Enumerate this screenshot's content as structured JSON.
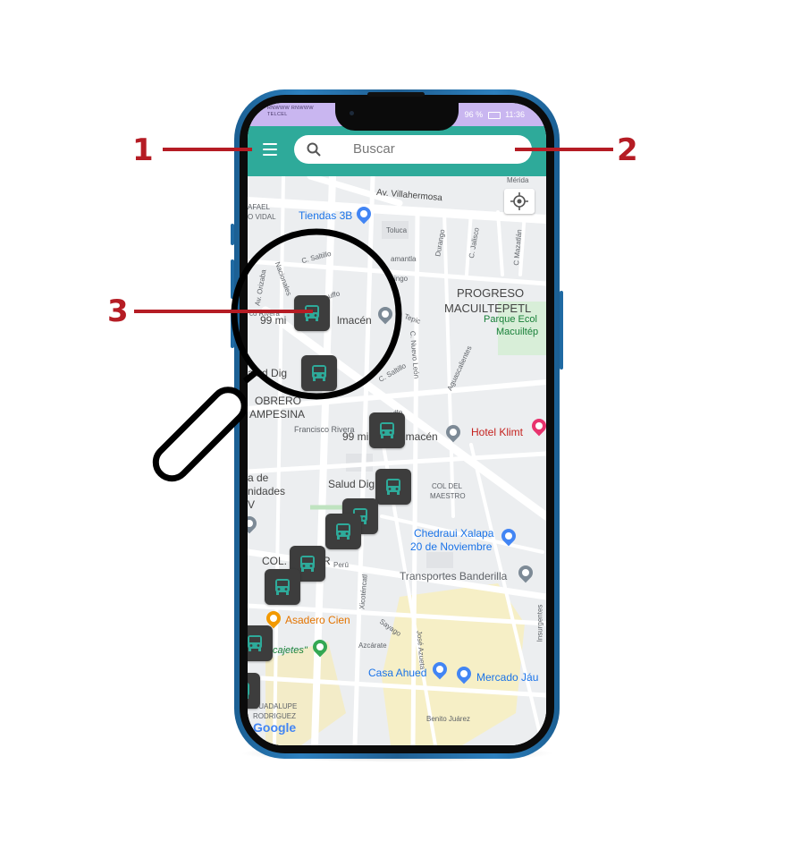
{
  "status_bar": {
    "carrier_top": "RNWWW RNWWW",
    "carrier": "TELCEL",
    "battery": "96 %",
    "time": "11:36"
  },
  "search": {
    "placeholder": "Buscar"
  },
  "map_labels": {
    "av_villahermosa": "Av. Villahermosa",
    "tiendas_3b": "Tiendas 3B",
    "rafael": "AFAEL",
    "vidal": "O VIDAL",
    "toluca": "Toluca",
    "durango": "Durango",
    "c_jalisco": "C. Jalisco",
    "c_mazatlan": "C Mazatlán",
    "merida": "Mérida",
    "c_saltillo": "C. Saltillo",
    "amantla": "amantla",
    "cingo": "cingo",
    "nacionales": "Nacionales",
    "av_orizaba": "Av. Orizaba",
    "ruffo": "uffo",
    "progreso": "PROGRESO",
    "macuiltepetl": "MACUILTEPETL",
    "parque_ecol": "Parque Ecol",
    "macuiltep": "Macuiltép",
    "co_rivera": "co Rivera",
    "99_minutos_top": "99 mi",
    "almacen_top": "lmacén",
    "tepic": "Tepic",
    "c_nuevo_leon": "C. Nuevo León",
    "c_saltillo_2": "C. Saltillo",
    "aguascalientes": "Aguascalientes",
    "salud_digna_top": "alud Dig",
    "obrero": "OBRERO",
    "campesina": "AMPESINA",
    "francisco_rivera": "Francisco Rivera",
    "ruffo_2": "uffo",
    "99_minutos": "99 mi",
    "almacen": "lmacén",
    "hotel_klimt": "Hotel Klimt",
    "a_de": "a de",
    "unidades": "nidades",
    "v": "V",
    "salud_digna": "Salud Dig",
    "col_del_maestro": "COL DEL MAESTRO",
    "col_del_maestro_1": "COL DEL",
    "col_del_maestro_2": "MAESTRO",
    "chedraui_1": "Chedraui Xalapa",
    "chedraui_2": "20 de Noviembre",
    "col": "COL.",
    "r": "R",
    "peru": "Perú",
    "transportes": "Transportes Banderilla",
    "xicotencatl": "Xicoténcatl",
    "asadero": "Asadero Cien",
    "sayago": "Sayago",
    "azcarate": "Azcárate",
    "jose_azueta": "José Azueta",
    "insurgentes": "Insurgentes",
    "cajetes": "cajetes\"",
    "casa_ahued": "Casa Ahued",
    "mercado": "Mercado Jáu",
    "guadalupe": "GUADALUPE",
    "rodriguez": "RODRIGUEZ",
    "benito_juarez": "Benito Juárez",
    "google": "Google"
  },
  "callouts": {
    "one": "1",
    "two": "2",
    "three": "3"
  },
  "icons": {
    "menu": "menu-icon",
    "search": "search-icon",
    "locate": "my-location-icon",
    "bus": "bus-icon",
    "magnifier": "magnifying-glass-icon"
  },
  "colors": {
    "app_bar": "#2eaa9a",
    "status_bar": "#c9b6f0",
    "callout": "#b51c24",
    "bus_marker": "#3d3d3d",
    "bus_icon": "#2eaa9a",
    "phone_frame": "#2c7fbd"
  }
}
